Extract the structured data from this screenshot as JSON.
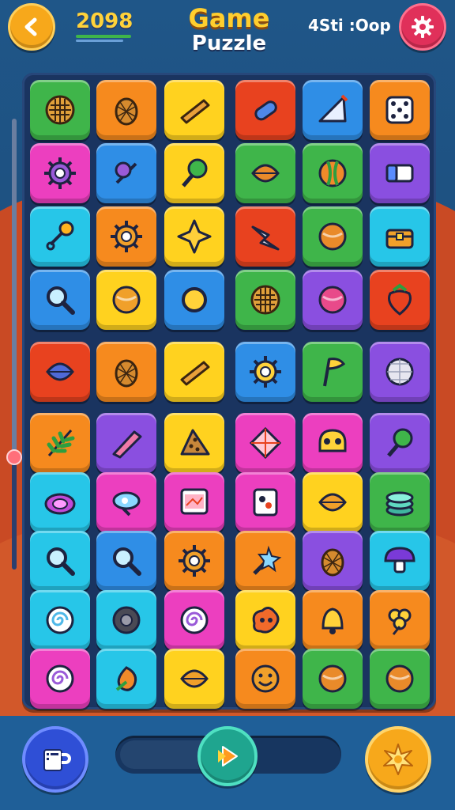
{
  "header": {
    "score": "2098",
    "title_line1": "Game",
    "title_line2": "Puzzle",
    "timer": "4Sti :Oop"
  },
  "icons": {
    "back": "back-arrow-icon",
    "settings": "gear-icon",
    "left_bottom": "cup-icon",
    "center_bottom": "play-icon",
    "right_bottom": "star-burst-icon"
  },
  "colors": {
    "accent_yellow": "#ffce2e",
    "settings_red": "#e0305a",
    "board_bg": "#1a3460"
  },
  "level_slider": {
    "value": 0.25
  },
  "bottom_progress": {
    "value": 0.45
  },
  "board": {
    "groups": [
      {
        "rows": [
          [
            "green:waffle",
            "orange:pinecone",
            "yellow:wedge",
            "red:bottle",
            "blue:ruler",
            "orange:dice"
          ],
          [
            "magenta:gear",
            "blue:pin",
            "yellow:lollipop",
            "green:leaf",
            "green:stripe-ball",
            "purple:eraser"
          ],
          [
            "cyan:key",
            "orange:gear",
            "yellow:star",
            "red:arrow",
            "green:ball",
            "cyan:chest"
          ],
          [
            "blue:magnifier",
            "yellow:ball",
            "blue:ring",
            "green:waffle",
            "purple:ball",
            "red:strawberry"
          ]
        ]
      },
      {
        "rows": [
          [
            "red:leaf",
            "orange:pinecone",
            "yellow:wedge",
            "blue:gear",
            "green:flag",
            "purple:disco-ball"
          ]
        ]
      },
      {
        "rows": [
          [
            "orange:fern",
            "purple:crystal",
            "yellow:cookie",
            "magenta:diamond",
            "magenta:skull",
            "purple:lollipop"
          ],
          [
            "cyan:disc",
            "magenta:gem",
            "magenta:picture",
            "magenta:card",
            "yellow:leaf",
            "green:coins"
          ],
          [
            "cyan:magnifier",
            "blue:magnifier",
            "orange:gear",
            "orange:star-sword",
            "purple:pinecone",
            "cyan:mushroom"
          ],
          [
            "cyan:swirl",
            "cyan:tire",
            "magenta:swirl",
            "yellow:splat",
            "orange:bell",
            "orange:clover"
          ],
          [
            "magenta:swirl",
            "cyan:shell",
            "yellow:leaf",
            "orange:smiley",
            "green:ball",
            "green:ball"
          ]
        ]
      }
    ]
  }
}
